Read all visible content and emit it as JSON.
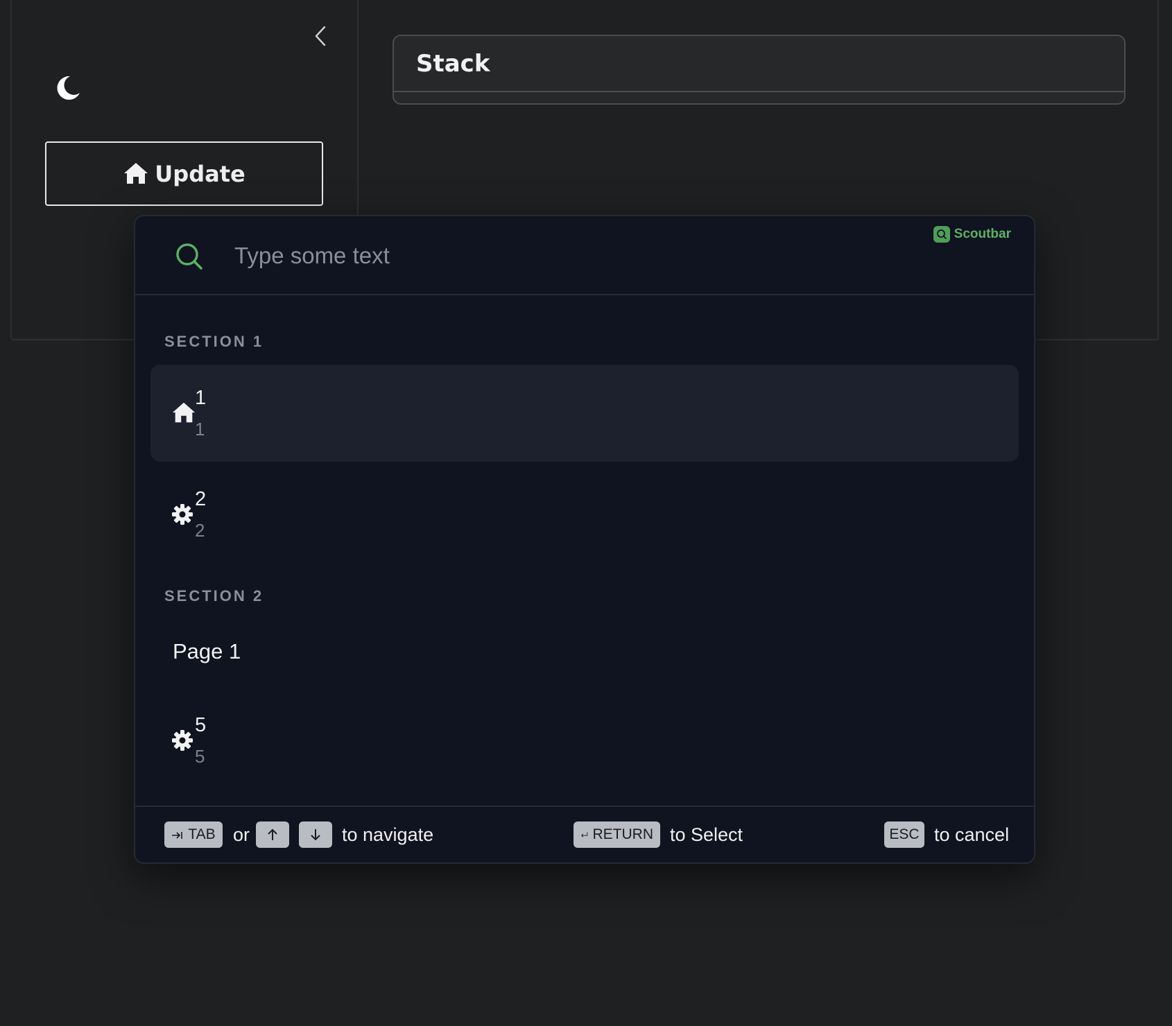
{
  "stack": {
    "title": "Stack"
  },
  "sidebar": {
    "update_label": "Update"
  },
  "scoutbar": {
    "brand": "Scoutbar",
    "search": {
      "placeholder": "Type some text",
      "value": ""
    },
    "sections": [
      {
        "title": "SECTION 1",
        "items": [
          {
            "icon": "home-icon",
            "title": "1",
            "description": "1",
            "active": true
          },
          {
            "icon": "gear-icon",
            "title": "2",
            "description": "2",
            "active": false
          }
        ]
      },
      {
        "title": "SECTION 2",
        "items": [
          {
            "icon": "",
            "title": "Page 1",
            "description": ""
          },
          {
            "icon": "gear-icon",
            "title": "5",
            "description": "5"
          }
        ]
      }
    ],
    "footer": {
      "tab_key": "TAB",
      "or": "or",
      "navigate": "to navigate",
      "return_key": "RETURN",
      "select": "to Select",
      "esc_key": "ESC",
      "cancel": "to cancel"
    }
  },
  "colors": {
    "background": "#1f2022",
    "modal": "#101320",
    "accent": "#5db066",
    "active_item": "#1d202d"
  }
}
